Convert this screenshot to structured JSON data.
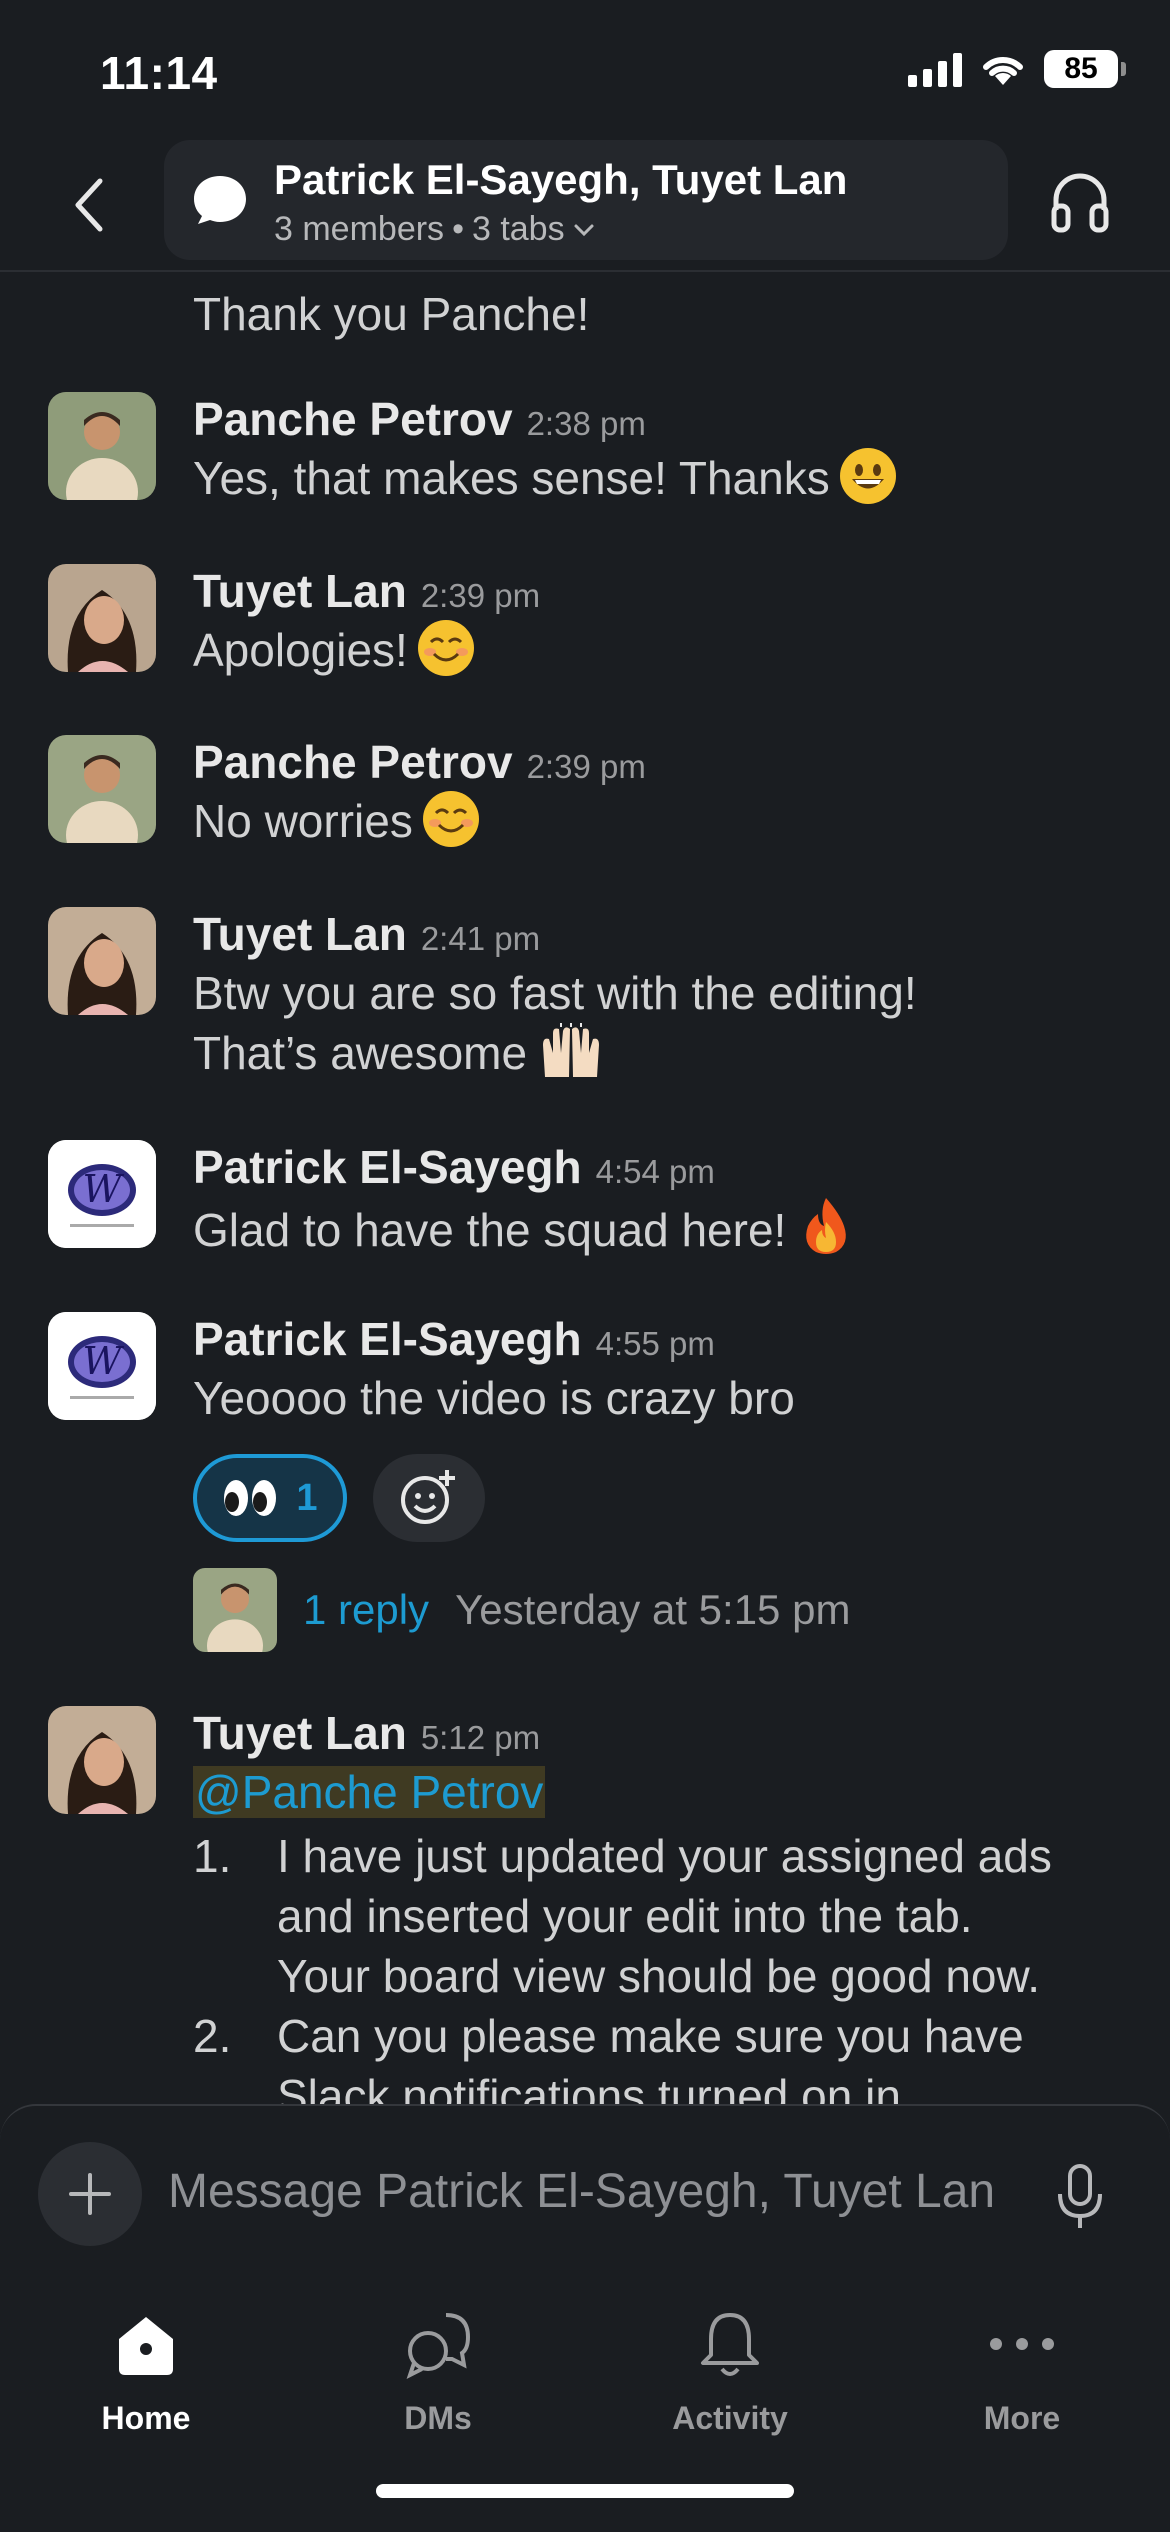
{
  "status_bar": {
    "time": "11:14",
    "battery": "85"
  },
  "header": {
    "title": "Patrick El-Sayegh, Tuyet Lan",
    "members": "3 members",
    "separator": "•",
    "tabs": "3 tabs"
  },
  "messages": {
    "partial_top": {
      "text": "Thank you Panche!"
    },
    "m1": {
      "author": "Panche Petrov",
      "time": "2:38 pm",
      "text": "Yes, that makes sense! Thanks",
      "emoji": "grinning-face"
    },
    "m2": {
      "author": "Tuyet Lan",
      "time": "2:39 pm",
      "text": "Apologies!",
      "emoji": "smiling-face"
    },
    "m3": {
      "author": "Panche Petrov",
      "time": "2:39 pm",
      "text": "No worries",
      "emoji": "smiling-face"
    },
    "m4": {
      "author": "Tuyet Lan",
      "time": "2:41 pm",
      "line1": "Btw you are so fast with the editing!",
      "line2": "That’s awesome",
      "emoji": "raising-hands"
    },
    "m5": {
      "author": "Patrick El-Sayegh",
      "time": "4:54 pm",
      "text": "Glad to have the squad here!",
      "emoji": "fire"
    },
    "m6": {
      "author": "Patrick El-Sayegh",
      "time": "4:55 pm",
      "text": "Yeoooo the video is crazy bro",
      "reaction": {
        "emoji": "eyes",
        "count": "1"
      },
      "thread": {
        "replies": "1 reply",
        "last_reply": "Yesterday at 5:15 pm"
      }
    },
    "m7": {
      "author": "Tuyet Lan",
      "time": "5:12 pm",
      "mention": "@Panche Petrov",
      "items": [
        {
          "num": "1.",
          "lines": [
            "I have just updated your assigned ads",
            "and inserted your edit into the tab.",
            "Your board view should be good now."
          ]
        },
        {
          "num": "2.",
          "lines": [
            "Can you please make sure you have",
            "Slack notifications turned on in"
          ]
        }
      ]
    }
  },
  "composer": {
    "placeholder": "Message Patrick El-Sayegh, Tuyet Lan"
  },
  "tabbar": {
    "home": "Home",
    "dms": "DMs",
    "activity": "Activity",
    "more": "More"
  },
  "colors": {
    "background": "#1a1d21",
    "link": "#1d9bd1",
    "reaction_border": "#1e9ad6",
    "mention_bg": "#3f3a22"
  }
}
